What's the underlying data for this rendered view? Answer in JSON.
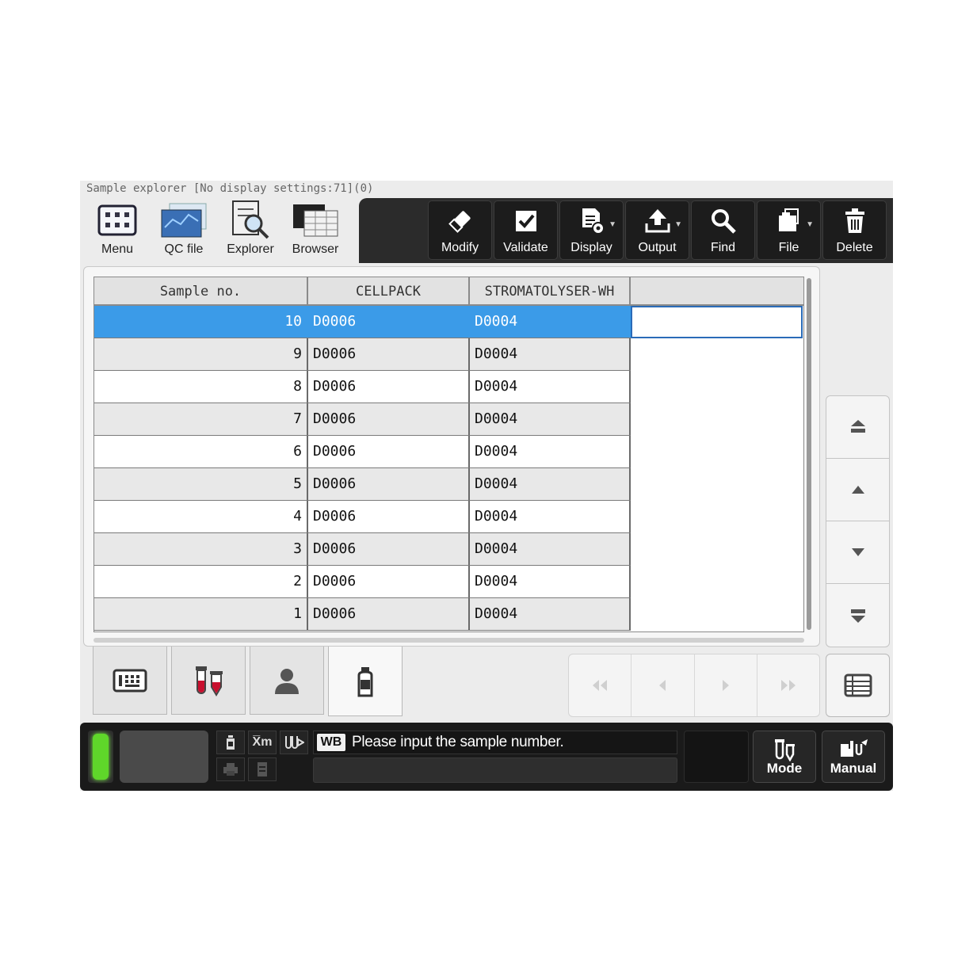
{
  "window": {
    "title": "Sample explorer [No display settings:71](0)"
  },
  "nav": [
    {
      "label": "Menu",
      "icon": "menu-keypad-icon"
    },
    {
      "label": "QC file",
      "icon": "qc-chart-icon"
    },
    {
      "label": "Explorer",
      "icon": "explorer-magnifier-icon"
    },
    {
      "label": "Browser",
      "icon": "browser-table-icon"
    }
  ],
  "toolbar": [
    {
      "label": "Modify",
      "icon": "eraser-icon"
    },
    {
      "label": "Validate",
      "icon": "checkbox-icon"
    },
    {
      "label": "Display",
      "icon": "document-gear-icon"
    },
    {
      "label": "Output",
      "icon": "upload-icon"
    },
    {
      "label": "Find",
      "icon": "search-icon"
    },
    {
      "label": "File",
      "icon": "file-copy-icon"
    },
    {
      "label": "Delete",
      "icon": "trash-icon"
    }
  ],
  "table": {
    "columns": [
      "Sample no.",
      "CELLPACK",
      "STROMATOLYSER-WH",
      ""
    ],
    "rows": [
      {
        "sample": "10",
        "cellpack": "D0006",
        "stromatolyser": "D0004"
      },
      {
        "sample": "9",
        "cellpack": "D0006",
        "stromatolyser": "D0004"
      },
      {
        "sample": "8",
        "cellpack": "D0006",
        "stromatolyser": "D0004"
      },
      {
        "sample": "7",
        "cellpack": "D0006",
        "stromatolyser": "D0004"
      },
      {
        "sample": "6",
        "cellpack": "D0006",
        "stromatolyser": "D0004"
      },
      {
        "sample": "5",
        "cellpack": "D0006",
        "stromatolyser": "D0004"
      },
      {
        "sample": "4",
        "cellpack": "D0006",
        "stromatolyser": "D0004"
      },
      {
        "sample": "3",
        "cellpack": "D0006",
        "stromatolyser": "D0004"
      },
      {
        "sample": "2",
        "cellpack": "D0006",
        "stromatolyser": "D0004"
      },
      {
        "sample": "1",
        "cellpack": "D0006",
        "stromatolyser": "D0004"
      }
    ],
    "selected_row": 0
  },
  "tabs": [
    {
      "icon": "keypad-card-icon"
    },
    {
      "icon": "blood-tubes-icon"
    },
    {
      "icon": "patient-icon"
    },
    {
      "icon": "reagent-bottle-icon",
      "active": true
    }
  ],
  "status": {
    "mode_chip": "WB",
    "message": "Please input the sample number.",
    "xm_label": "X̅m",
    "mode_label": "Mode",
    "manual_label": "Manual"
  },
  "colors": {
    "selected_row": "#3b9be8",
    "toolbar_bg": "#2b2b2b",
    "ready_led": "#5fd62a"
  }
}
